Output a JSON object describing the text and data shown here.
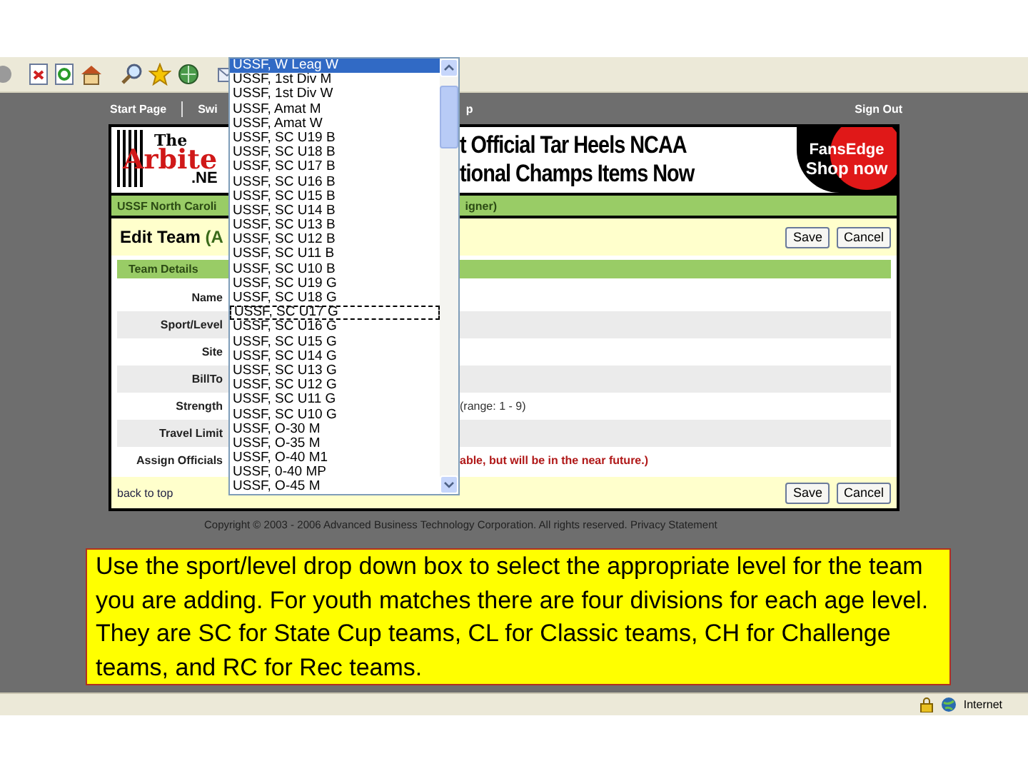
{
  "nav": {
    "links": [
      "Start Page",
      "Swi",
      "p"
    ],
    "sign_out": "Sign Out"
  },
  "banner": {
    "logo_top": "The",
    "logo_main": "Arbite",
    "logo_suffix": ".NE",
    "ad_lines": [
      "t Official Tar Heels NCAA",
      "tional Champs Items Now"
    ],
    "sponsor_top": "FansEdge",
    "sponsor_bottom": "Shop now"
  },
  "header_bar": {
    "left": "USSF North Caroli",
    "right": "igner)"
  },
  "edit_team": {
    "title": "Edit Team",
    "title_suffix": "(A",
    "buttons": [
      "Save",
      "Cancel"
    ]
  },
  "section_title": "Team Details",
  "fields": [
    {
      "label": "Name"
    },
    {
      "label": "Sport/Level"
    },
    {
      "label": "Site"
    },
    {
      "label": "BillTo"
    },
    {
      "label": "Strength",
      "note": "(range: 1 - 9)",
      "alert": false
    },
    {
      "label": "Travel Limit"
    },
    {
      "label": "Assign Officials",
      "note": "able, but will be in the near future.)",
      "alert": true
    }
  ],
  "footer": {
    "link": "back to top",
    "buttons": [
      "Save",
      "Cancel"
    ]
  },
  "copyright": "Copyright © 2003 - 2006 Advanced Business Technology Corporation. All rights reserved. Privacy Statement",
  "dropdown": {
    "options": [
      {
        "label": "USSF, W Leag W",
        "selected": true,
        "focused": false
      },
      {
        "label": "USSF, 1st Div M",
        "selected": false,
        "focused": false
      },
      {
        "label": "USSF, 1st Div W",
        "selected": false,
        "focused": false
      },
      {
        "label": "USSF, Amat M",
        "selected": false,
        "focused": false
      },
      {
        "label": "USSF, Amat W",
        "selected": false,
        "focused": false
      },
      {
        "label": "USSF, SC U19 B",
        "selected": false,
        "focused": false
      },
      {
        "label": "USSF, SC U18 B",
        "selected": false,
        "focused": false
      },
      {
        "label": "USSF, SC U17 B",
        "selected": false,
        "focused": false
      },
      {
        "label": "USSF, SC U16 B",
        "selected": false,
        "focused": false
      },
      {
        "label": "USSF, SC U15 B",
        "selected": false,
        "focused": false
      },
      {
        "label": "USSF, SC U14 B",
        "selected": false,
        "focused": false
      },
      {
        "label": "USSF, SC U13 B",
        "selected": false,
        "focused": false
      },
      {
        "label": "USSF, SC U12 B",
        "selected": false,
        "focused": false
      },
      {
        "label": "USSF, SC U11 B",
        "selected": false,
        "focused": false
      },
      {
        "label": "USSF, SC U10 B",
        "selected": false,
        "focused": false
      },
      {
        "label": "USSF, SC U19 G",
        "selected": false,
        "focused": false
      },
      {
        "label": "USSF, SC U18 G",
        "selected": false,
        "focused": false
      },
      {
        "label": "USSF, SC U17 G",
        "selected": false,
        "focused": true
      },
      {
        "label": "USSF, SC U16 G",
        "selected": false,
        "focused": false
      },
      {
        "label": "USSF, SC U15 G",
        "selected": false,
        "focused": false
      },
      {
        "label": "USSF, SC U14 G",
        "selected": false,
        "focused": false
      },
      {
        "label": "USSF, SC U13 G",
        "selected": false,
        "focused": false
      },
      {
        "label": "USSF, SC U12 G",
        "selected": false,
        "focused": false
      },
      {
        "label": "USSF, SC U11 G",
        "selected": false,
        "focused": false
      },
      {
        "label": "USSF, SC U10 G",
        "selected": false,
        "focused": false
      },
      {
        "label": "USSF, O-30 M",
        "selected": false,
        "focused": false
      },
      {
        "label": "USSF, O-35 M",
        "selected": false,
        "focused": false
      },
      {
        "label": "USSF, O-40 M1",
        "selected": false,
        "focused": false
      },
      {
        "label": "USSF, 0-40 MP",
        "selected": false,
        "focused": false
      },
      {
        "label": "USSF, O-45 M",
        "selected": false,
        "focused": false
      }
    ]
  },
  "callout": "Use the sport/level drop down box to select the appropriate level for the team you are adding.  For youth matches there are four divisions for each age level.  They are SC for State Cup teams, CL for Classic teams, CH for Challenge teams, and RC for Rec teams.",
  "status_bar": {
    "zone": "Internet"
  }
}
